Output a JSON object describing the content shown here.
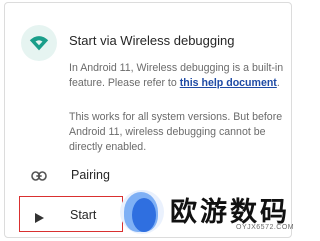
{
  "card": {
    "title": "Start via Wireless debugging",
    "para1_prefix": "In Android 11, Wireless debugging is a built-in feature. Please refer to ",
    "para1_link": "this help document",
    "para1_suffix": ".",
    "para2": "This works for all system versions. But before Android 11, wireless debugging cannot be directly enabled."
  },
  "actions": {
    "pairing_label": "Pairing",
    "start_label": "Start"
  },
  "watermark": {
    "text": "欧游数码",
    "url": "OYJX6572.COM"
  },
  "colors": {
    "accent": "#1a9e8a",
    "link": "#1f4ba5",
    "highlight_border": "#d93030"
  }
}
